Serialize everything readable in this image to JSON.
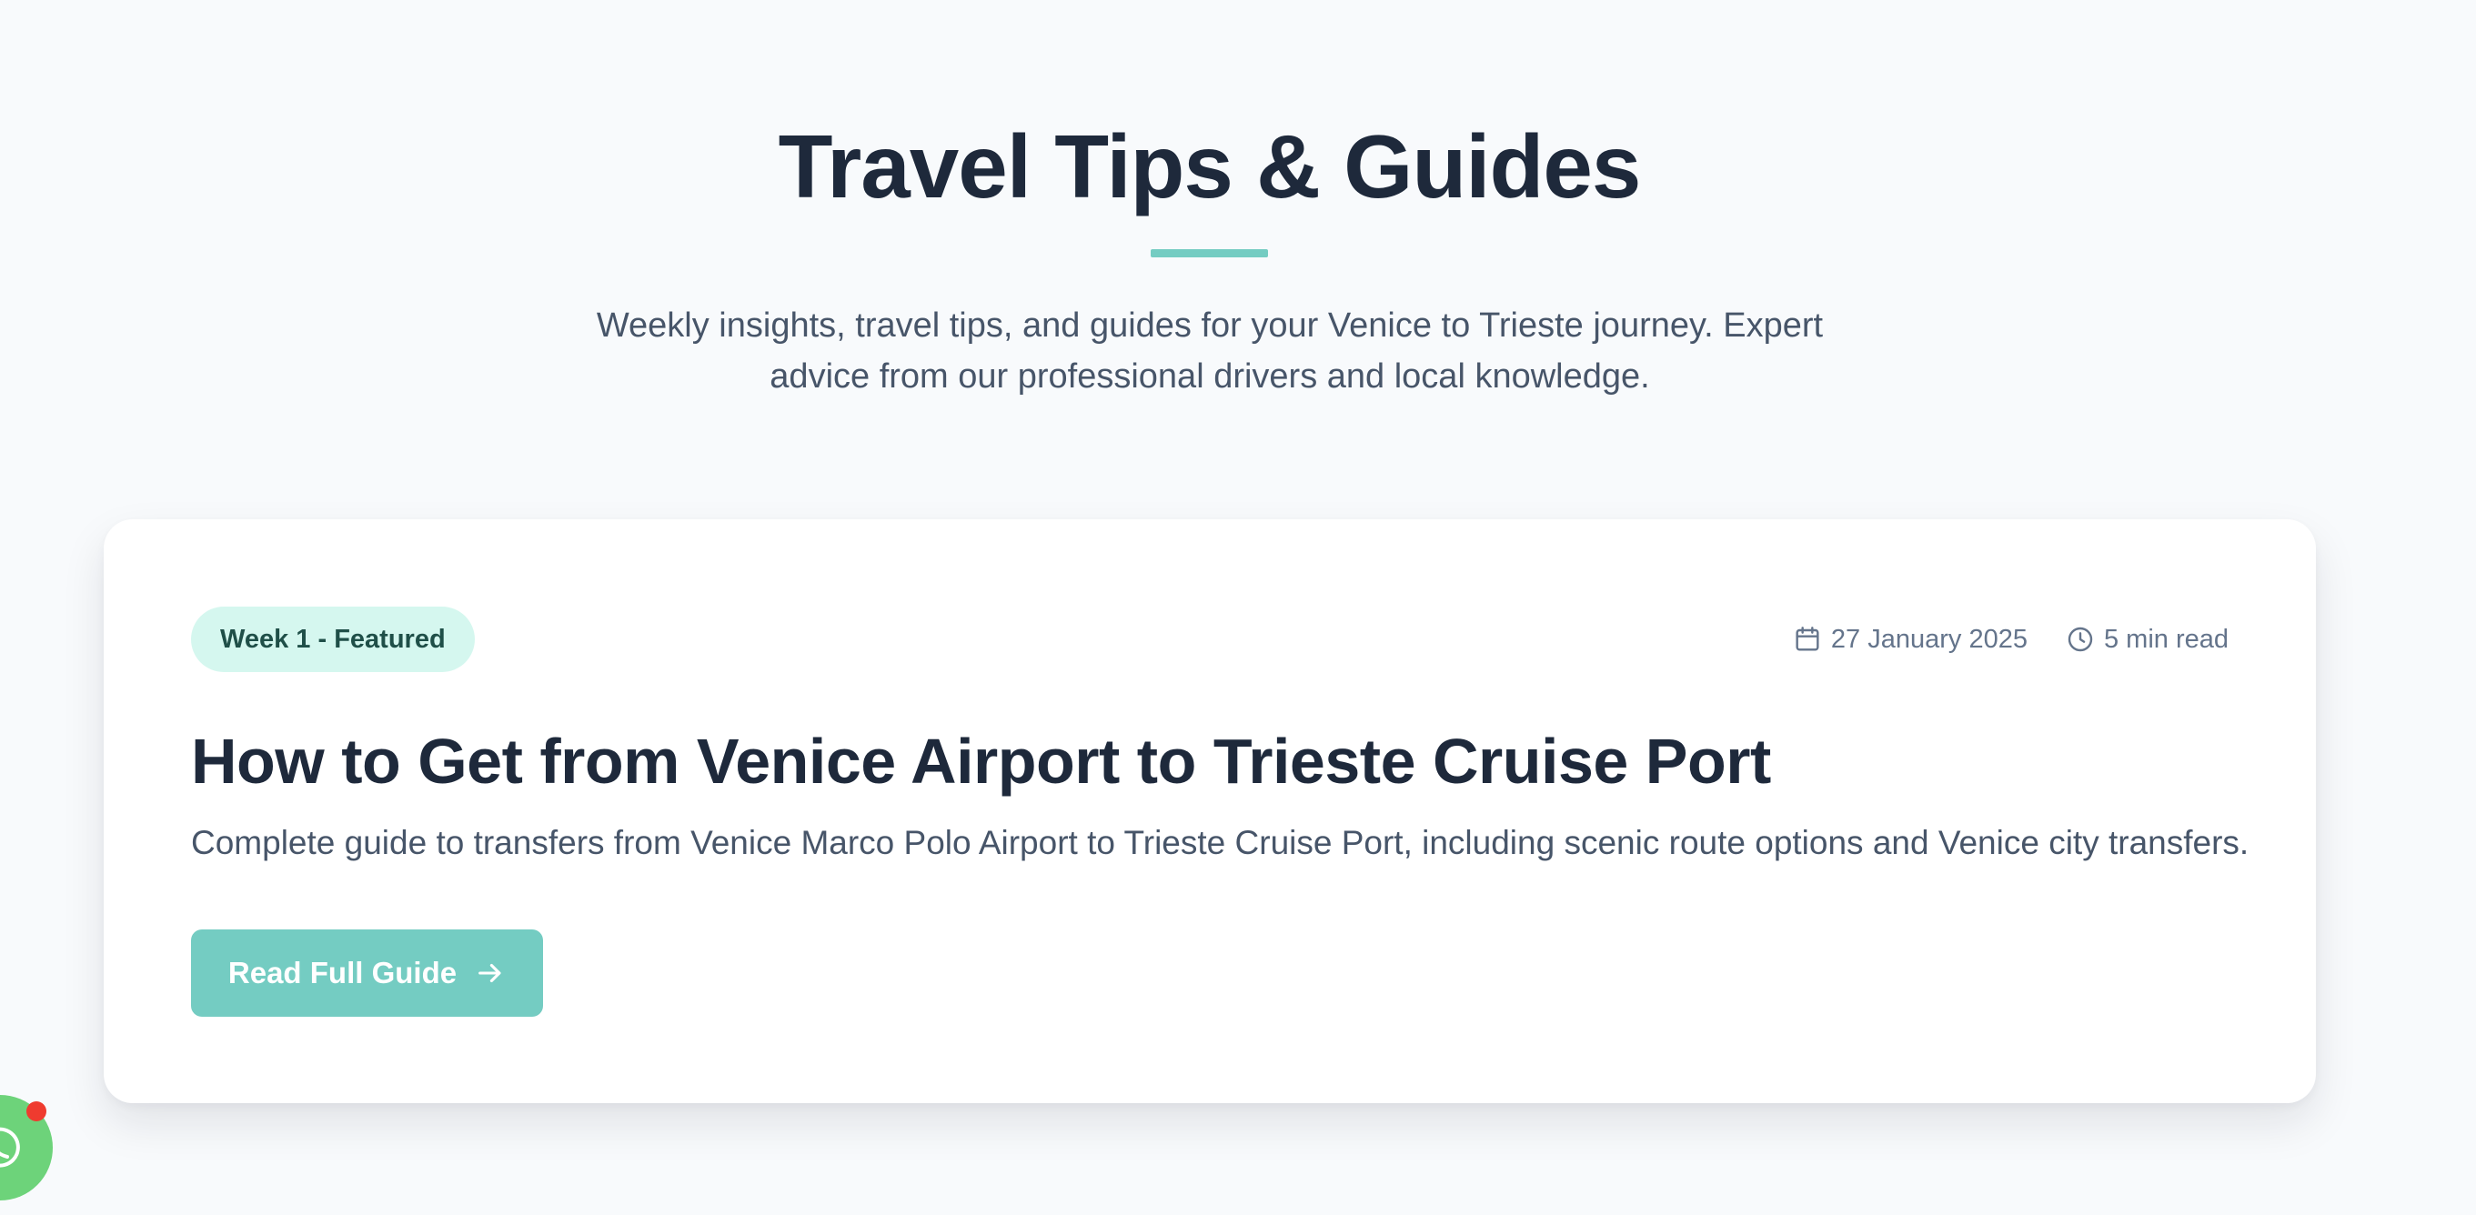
{
  "header": {
    "title": "Travel Tips & Guides",
    "subtitle_line1": "Weekly insights, travel tips, and guides for your Venice to Trieste journey. Expert",
    "subtitle_line2": "advice from our professional drivers and local knowledge."
  },
  "featured": {
    "badge": "Week 1 - Featured",
    "date": "27 January 2025",
    "read_time": "5 min read",
    "title": "How to Get from Venice Airport to Trieste Cruise Port",
    "description": "Complete guide to transfers from Venice Marco Polo Airport to Trieste Cruise Port, including scenic route options and Venice city transfers.",
    "cta_label": "Read Full Guide",
    "icons": {
      "date": "calendar-icon",
      "read_time": "clock-icon",
      "cta": "arrow-right-icon"
    }
  },
  "chat_widget": {
    "icon": "whatsapp-icon",
    "has_notification": true
  },
  "colors": {
    "accent": "#74ccc2",
    "badge_bg": "#d5f7ef",
    "title": "#1e293b",
    "chat": "#6dd37a",
    "notification": "#ef3b2f",
    "background": "#f8fafc"
  }
}
